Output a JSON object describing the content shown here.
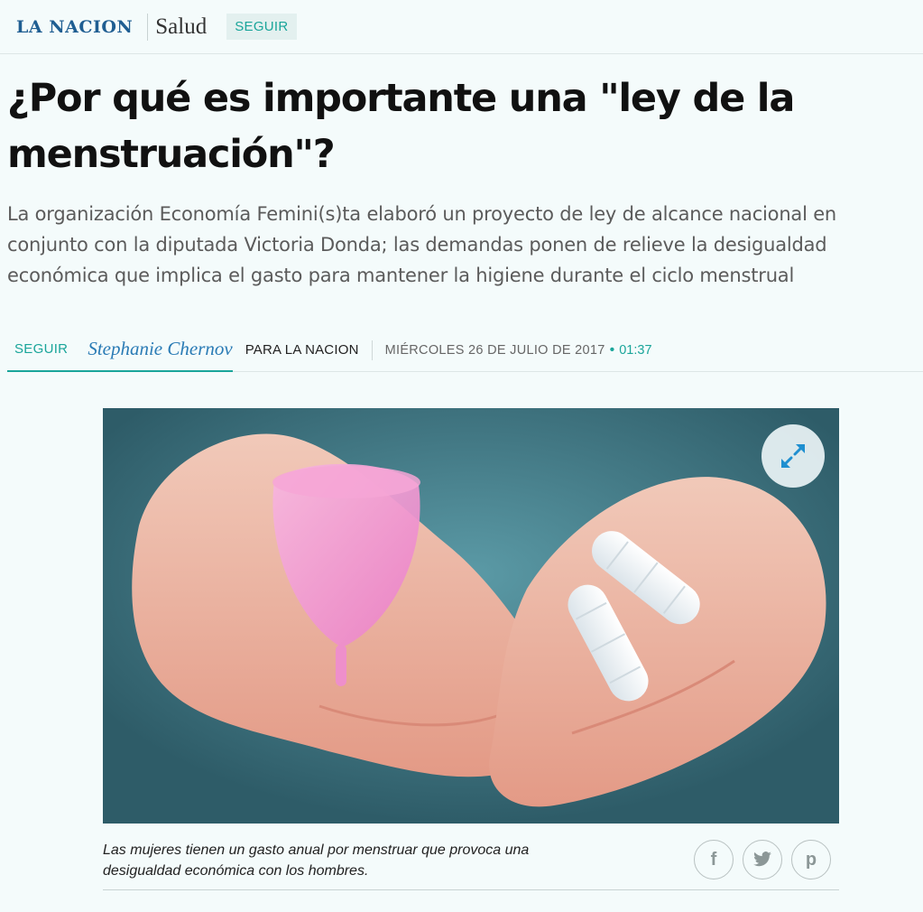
{
  "header": {
    "logo": "LA NACION",
    "section": "Salud",
    "follow_label": "SEGUIR"
  },
  "article": {
    "title": "¿Por qué es importante una \"ley de la menstruación\"?",
    "subtitle": "La organización Economía Femini(s)ta elaboró un proyecto de ley de alcance nacional en conjunto con la diputada Victoria Donda; las demandas ponen de relieve la desigualdad económica que implica el gasto para mantener la higiene durante el ciclo menstrual"
  },
  "byline": {
    "follow_label": "SEGUIR",
    "author": "Stephanie Chernov",
    "outlet": "PARA LA NACION",
    "date": "MIÉRCOLES 26 DE JULIO DE 2017",
    "separator": "•",
    "time": "01:37"
  },
  "image": {
    "caption": "Las mujeres tienen un gasto anual por menstruar que provoca una desigualdad económica con los hombres.",
    "expand_icon": "expand-arrows-icon"
  },
  "share": {
    "facebook_icon": "facebook-icon",
    "twitter_icon": "twitter-icon",
    "pinterest_icon": "pinterest-icon",
    "facebook_glyph": "f",
    "pinterest_glyph": "p"
  },
  "colors": {
    "accent": "#1aa59a",
    "logo": "#1f5e92",
    "author": "#2a7bb5",
    "background": "#f4fbfb"
  }
}
